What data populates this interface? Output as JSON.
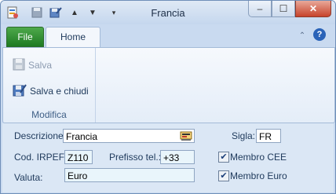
{
  "window": {
    "title": "Francia",
    "controls": {
      "minimize": "–",
      "maximize": "☐",
      "close": "✕"
    }
  },
  "quick_access": [
    "app-icon",
    "save-icon",
    "save-close-icon",
    "up-arrow-icon",
    "down-arrow-icon",
    "dropdown-icon"
  ],
  "ribbon": {
    "tabs": [
      {
        "label": "File"
      },
      {
        "label": "Home"
      }
    ],
    "active_tab": "Home",
    "help_icon": "?",
    "groups": [
      {
        "label": "Modifica",
        "buttons": [
          {
            "label": "Salva",
            "enabled": false,
            "icon": "save-icon"
          },
          {
            "label": "Salva e chiudi",
            "enabled": true,
            "icon": "save-close-icon"
          }
        ]
      }
    ]
  },
  "form": {
    "descrizione": {
      "label": "Descrizione:",
      "value": "Francia"
    },
    "sigla": {
      "label": "Sigla:",
      "value": "FR"
    },
    "cod_irpef": {
      "label": "Cod. IRPEF:",
      "value": "Z110"
    },
    "prefisso": {
      "label": "Prefisso tel.:",
      "value": "+33"
    },
    "valuta": {
      "label": "Valuta:",
      "value": "Euro"
    },
    "membro_cee": {
      "label": "Membro CEE",
      "checked": true
    },
    "membro_euro": {
      "label": "Membro Euro",
      "checked": true
    }
  },
  "colors": {
    "accent": "#1e7a22",
    "frame": "#c9daf0",
    "text": "#1e395b"
  }
}
